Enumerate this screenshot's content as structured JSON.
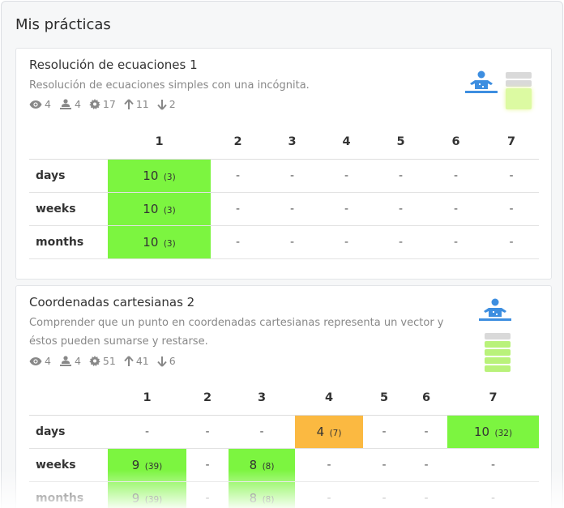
{
  "page": {
    "title": "Mis prácticas"
  },
  "colors": {
    "green": "#7cf540",
    "orange": "#fbb941",
    "icon_blue": "#3d8ee0"
  },
  "practices": [
    {
      "title": "Resolución de ecuaciones 1",
      "description": "Resolución de ecuaciones simples con una incógnita.",
      "stats": {
        "views": "4",
        "students": "4",
        "settings": "17",
        "up": "11",
        "down": "2"
      },
      "columns": [
        "1",
        "2",
        "3",
        "4",
        "5",
        "6",
        "7"
      ],
      "rows": [
        {
          "label": "days",
          "cells": [
            {
              "v": "10",
              "c": "(3)"
            },
            {
              "v": "-"
            },
            {
              "v": "-"
            },
            {
              "v": "-"
            },
            {
              "v": "-"
            },
            {
              "v": "-"
            },
            {
              "v": "-"
            }
          ]
        },
        {
          "label": "weeks",
          "cells": [
            {
              "v": "10",
              "c": "(3)"
            },
            {
              "v": "-"
            },
            {
              "v": "-"
            },
            {
              "v": "-"
            },
            {
              "v": "-"
            },
            {
              "v": "-"
            },
            {
              "v": "-"
            }
          ]
        },
        {
          "label": "months",
          "cells": [
            {
              "v": "10",
              "c": "(3)"
            },
            {
              "v": "-"
            },
            {
              "v": "-"
            },
            {
              "v": "-"
            },
            {
              "v": "-"
            },
            {
              "v": "-"
            },
            {
              "v": "-"
            }
          ]
        }
      ]
    },
    {
      "title": "Coordenadas cartesianas 2",
      "description": "Comprender que un punto en coordenadas cartesianas representa un vector y éstos pueden sumarse y restarse.",
      "stats": {
        "views": "4",
        "students": "4",
        "settings": "51",
        "up": "41",
        "down": "6"
      },
      "columns": [
        "1",
        "2",
        "3",
        "4",
        "5",
        "6",
        "7"
      ],
      "rows": [
        {
          "label": "days",
          "cells": [
            {
              "v": "-"
            },
            {
              "v": "-"
            },
            {
              "v": "-"
            },
            {
              "v": "4",
              "c": "(7)"
            },
            {
              "v": "-"
            },
            {
              "v": "-"
            },
            {
              "v": "10",
              "c": "(32)"
            }
          ]
        },
        {
          "label": "weeks",
          "cells": [
            {
              "v": "9",
              "c": "(39)"
            },
            {
              "v": "-"
            },
            {
              "v": "8",
              "c": "(8)"
            },
            {
              "v": "-"
            },
            {
              "v": "-"
            },
            {
              "v": "-"
            },
            {
              "v": "-"
            }
          ]
        },
        {
          "label": "months",
          "cells": [
            {
              "v": "9",
              "c": "(39)"
            },
            {
              "v": "-"
            },
            {
              "v": "8",
              "c": "(8)"
            },
            {
              "v": "-"
            },
            {
              "v": "-"
            },
            {
              "v": "-"
            },
            {
              "v": "-"
            }
          ]
        }
      ]
    }
  ]
}
